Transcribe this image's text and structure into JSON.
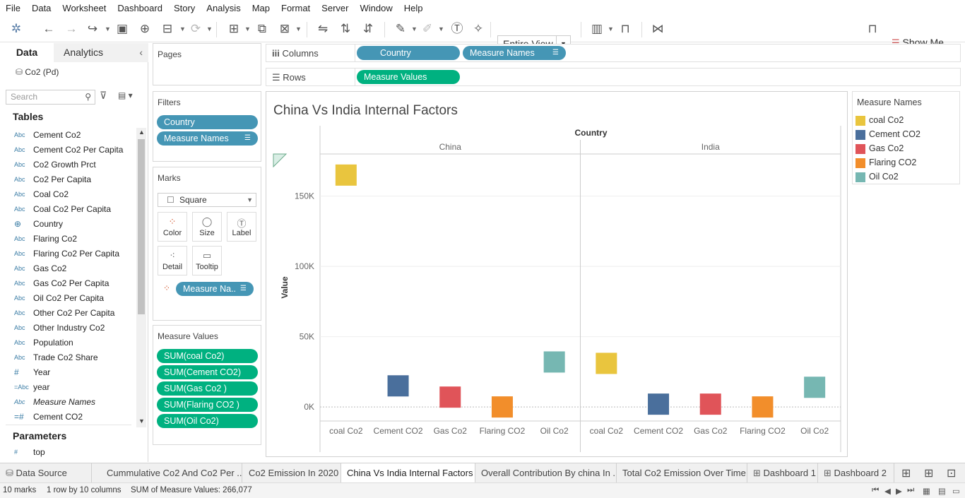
{
  "menu": [
    "File",
    "Data",
    "Worksheet",
    "Dashboard",
    "Story",
    "Analysis",
    "Map",
    "Format",
    "Server",
    "Window",
    "Help"
  ],
  "toolbar": {
    "view_select": "Entire View",
    "show_me": "Show Me"
  },
  "left_pane": {
    "tab_data": "Data",
    "tab_analytics": "Analytics",
    "data_source": "Co2  (Pd)",
    "search_placeholder": "Search",
    "tables_title": "Tables",
    "fields": [
      {
        "type": "Abc",
        "name": "Cement Co2"
      },
      {
        "type": "Abc",
        "name": "Cement Co2 Per Capita"
      },
      {
        "type": "Abc",
        "name": "Co2 Growth Prct"
      },
      {
        "type": "Abc",
        "name": "Co2 Per Capita"
      },
      {
        "type": "Abc",
        "name": "Coal Co2"
      },
      {
        "type": "Abc",
        "name": "Coal Co2 Per Capita"
      },
      {
        "type": "globe",
        "name": "Country"
      },
      {
        "type": "Abc",
        "name": "Flaring Co2"
      },
      {
        "type": "Abc",
        "name": "Flaring Co2 Per Capita"
      },
      {
        "type": "Abc",
        "name": "Gas Co2"
      },
      {
        "type": "Abc",
        "name": "Gas Co2 Per Capita"
      },
      {
        "type": "Abc",
        "name": "Oil Co2 Per Capita"
      },
      {
        "type": "Abc",
        "name": "Other Co2 Per Capita"
      },
      {
        "type": "Abc",
        "name": "Other Industry Co2"
      },
      {
        "type": "Abc",
        "name": "Population"
      },
      {
        "type": "Abc",
        "name": "Trade Co2 Share"
      },
      {
        "type": "#",
        "name": "Year"
      },
      {
        "type": "=Abc",
        "name": "year"
      },
      {
        "type": "Abc",
        "name": "Measure Names"
      },
      {
        "type": "=#",
        "name": "Cement CO2"
      }
    ],
    "parameters_title": "Parameters",
    "parameters": [
      {
        "type": "#",
        "name": "top"
      }
    ]
  },
  "pages": {
    "title": "Pages"
  },
  "filters": {
    "title": "Filters",
    "pills": [
      "Country",
      "Measure Names"
    ]
  },
  "marks": {
    "title": "Marks",
    "type": "Square",
    "buttons": [
      "Color",
      "Size",
      "Label",
      "Detail",
      "Tooltip"
    ],
    "pill": "Measure Na.."
  },
  "measure_values": {
    "title": "Measure Values",
    "pills": [
      "SUM(coal Co2)",
      "SUM(Cement CO2)",
      "SUM(Gas Co2 )",
      "SUM(Flaring CO2 )",
      "SUM(Oil Co2)"
    ]
  },
  "shelves": {
    "columns_label": "Columns",
    "columns_pills": [
      "Country",
      "Measure Names"
    ],
    "rows_label": "Rows",
    "rows_pills": [
      "Measure Values"
    ]
  },
  "legend": {
    "title": "Measure Names",
    "items": [
      {
        "label": "coal Co2",
        "color": "#e9c53e"
      },
      {
        "label": "Cement CO2",
        "color": "#4a6f9c"
      },
      {
        "label": "Gas Co2",
        "color": "#e05459"
      },
      {
        "label": "Flaring CO2",
        "color": "#f28e2b"
      },
      {
        "label": "Oil Co2",
        "color": "#76b7b2"
      }
    ]
  },
  "chart_data": {
    "type": "scatter",
    "mark": "square",
    "title": "China Vs India Internal Factors",
    "column_header": "Country",
    "panes": [
      "China",
      "India"
    ],
    "categories": [
      "coal Co2",
      "Cement CO2",
      "Gas Co2",
      "Flaring CO2",
      "Oil Co2"
    ],
    "colors": [
      "#e9c53e",
      "#4a6f9c",
      "#e05459",
      "#f28e2b",
      "#76b7b2"
    ],
    "values": {
      "China": [
        165000,
        15000,
        7000,
        0,
        32000
      ],
      "India": [
        31000,
        2000,
        2000,
        0,
        14000
      ]
    },
    "ylabel": "Value",
    "ylim": [
      -10000,
      180000
    ],
    "yticks": [
      0,
      50000,
      100000,
      150000
    ],
    "ytick_labels": [
      "0K",
      "50K",
      "100K",
      "150K"
    ]
  },
  "sheet_tabs": [
    "Data Source",
    "Cummulative Co2 And Co2 Per ...",
    "Co2 Emission In 2020",
    "China Vs India Internal Factors",
    "Overall Contribution By china In ...",
    "Total Co2 Emission Over Time",
    "Dashboard 1",
    "Dashboard 2"
  ],
  "status": {
    "marks": "10 marks",
    "layout": "1 row by 10 columns",
    "sum": "SUM of Measure Values: 266,077"
  }
}
